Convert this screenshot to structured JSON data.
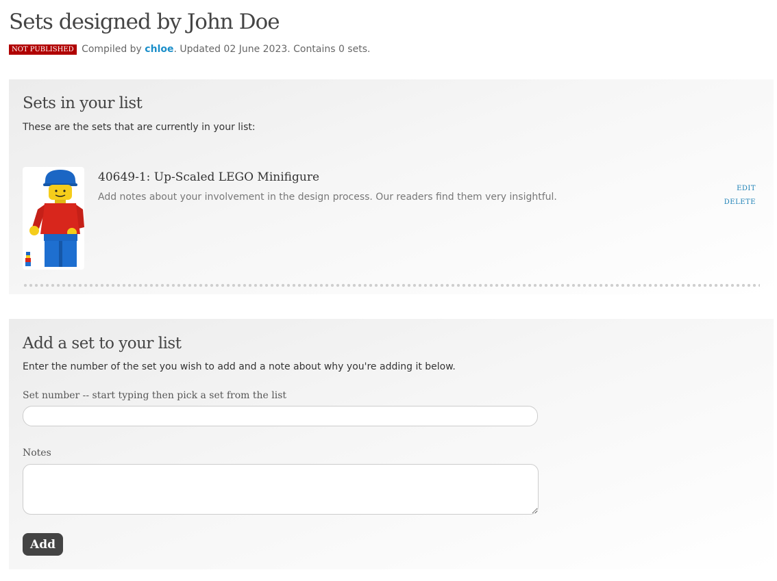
{
  "page": {
    "title": "Sets designed by John Doe",
    "status_badge": "NOT PUBLISHED",
    "compiled_by_label": "Compiled by",
    "author": "chloe",
    "meta_suffix": ". Updated 02 June 2023. Contains 0 sets."
  },
  "list_section": {
    "title": "Sets in your list",
    "description": "These are the sets that are currently in your list:",
    "items": [
      {
        "title": "40649-1: Up-Scaled LEGO Minifigure",
        "notes": "Add notes about your involvement in the design process. Our readers find them very insightful.",
        "edit_label": "EDIT",
        "delete_label": "DELETE"
      }
    ]
  },
  "add_section": {
    "title": "Add a set to your list",
    "description": "Enter the number of the set you wish to add and a note about why you're adding it below.",
    "set_number_label": "Set number -- start typing then pick a set from the list",
    "set_number_value": "",
    "notes_label": "Notes",
    "notes_value": "",
    "add_button_label": "Add"
  },
  "colors": {
    "badge": "#b00000",
    "link": "#1a8ec9",
    "button": "#444444"
  }
}
